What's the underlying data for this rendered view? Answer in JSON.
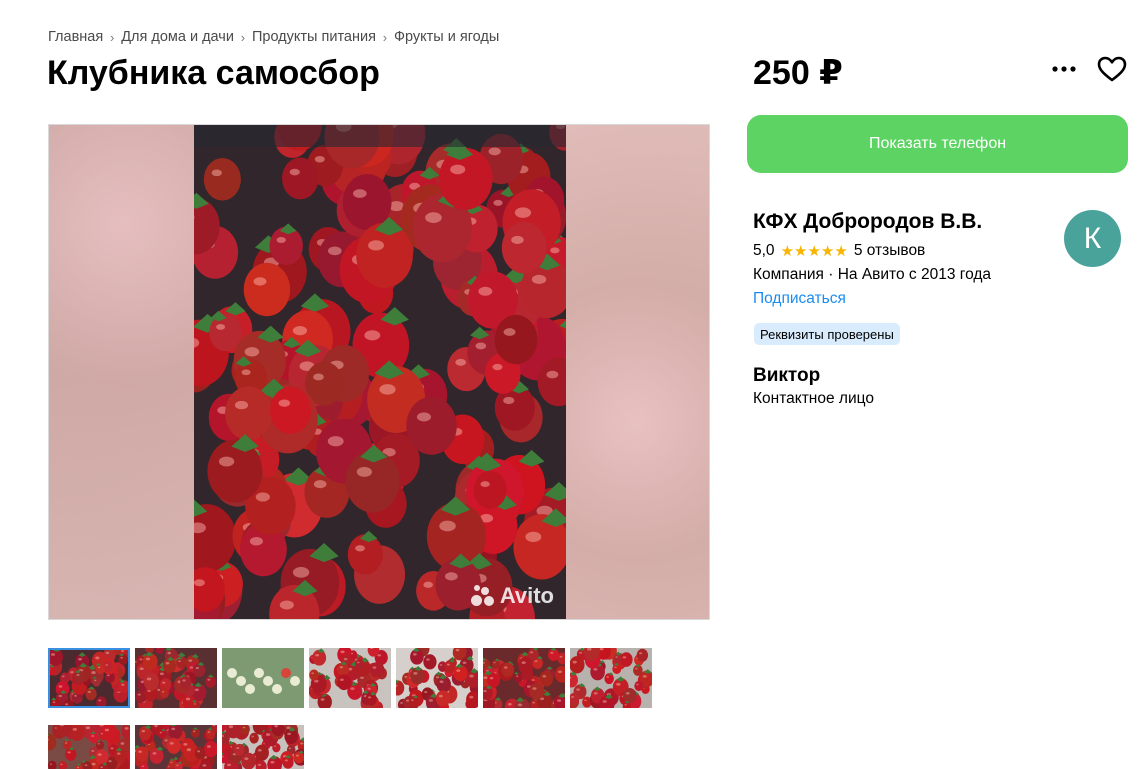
{
  "breadcrumb": {
    "items": [
      "Главная",
      "Для дома и дачи",
      "Продукты питания",
      "Фрукты и ягоды"
    ],
    "separator": "›"
  },
  "listing": {
    "title": "Клубника самосбор",
    "price": "250 ₽"
  },
  "actions": {
    "more_icon": "more-horizontal-icon",
    "favorite_icon": "heart-icon",
    "show_phone_label": "Показать телефон",
    "show_phone_color": "#5dd364"
  },
  "gallery": {
    "watermark": "Avito",
    "thumbnails_count": 10,
    "active_thumbnail": 0
  },
  "seller": {
    "name": "КФХ Доброродов В.В.",
    "rating": "5,0",
    "stars": 5,
    "reviews": "5 отзывов",
    "meta": "Компания · На Авито с 2013 года",
    "subscribe_label": "Подписаться",
    "verified_badge": "Реквизиты проверены",
    "avatar_letter": "К",
    "avatar_color": "#4aa39b"
  },
  "contact": {
    "name": "Виктор",
    "role": "Контактное лицо"
  }
}
